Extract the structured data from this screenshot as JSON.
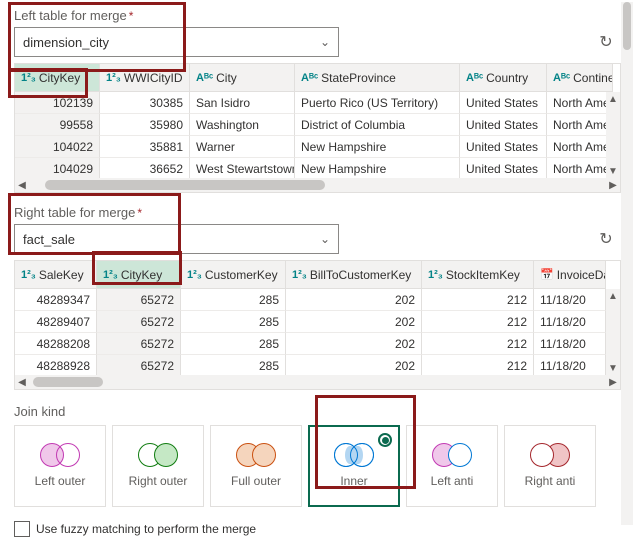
{
  "left": {
    "label": "Left table for merge",
    "selected": "dimension_city",
    "columns": [
      "CityKey",
      "WWICityID",
      "City",
      "StateProvince",
      "Country",
      "Continent"
    ],
    "types": [
      "num",
      "num",
      "text",
      "text",
      "text",
      "text"
    ],
    "rows": [
      [
        "102139",
        "30385",
        "San Isidro",
        "Puerto Rico (US Territory)",
        "United States",
        "North Amer"
      ],
      [
        "99558",
        "35980",
        "Washington",
        "District of Columbia",
        "United States",
        "North Amer"
      ],
      [
        "104022",
        "35881",
        "Warner",
        "New Hampshire",
        "United States",
        "North Amer"
      ],
      [
        "104029",
        "36652",
        "West Stewartstown",
        "New Hampshire",
        "United States",
        "North Amer"
      ]
    ]
  },
  "right": {
    "label": "Right table for merge",
    "selected": "fact_sale",
    "columns": [
      "SaleKey",
      "CityKey",
      "CustomerKey",
      "BillToCustomerKey",
      "StockItemKey",
      "InvoiceDa"
    ],
    "types": [
      "num",
      "num",
      "num",
      "num",
      "num",
      "date"
    ],
    "rows": [
      [
        "48289347",
        "65272",
        "285",
        "202",
        "212",
        "11/18/20"
      ],
      [
        "48289407",
        "65272",
        "285",
        "202",
        "212",
        "11/18/20"
      ],
      [
        "48288208",
        "65272",
        "285",
        "202",
        "212",
        "11/18/20"
      ],
      [
        "48288928",
        "65272",
        "285",
        "202",
        "212",
        "11/18/20"
      ]
    ]
  },
  "join": {
    "label": "Join kind",
    "kinds": [
      "Left outer",
      "Right outer",
      "Full outer",
      "Inner",
      "Left anti",
      "Right anti"
    ]
  },
  "fuzzy": "Use fuzzy matching to perform the merge",
  "icons": {
    "num": "1²₃",
    "text": "Aᴮᶜ",
    "date": "📅"
  }
}
